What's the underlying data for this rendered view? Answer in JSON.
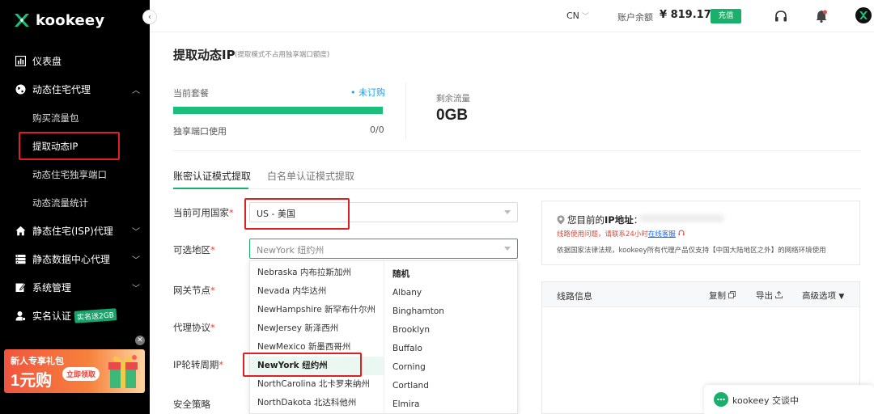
{
  "brand": {
    "name": "kookeey"
  },
  "sidebar": {
    "items": [
      {
        "label": "仪表盘",
        "icon": "dashboard-icon"
      },
      {
        "label": "动态住宅代理",
        "icon": "globe-icon",
        "expanded": true,
        "children": [
          "购买流量包",
          "提取动态IP",
          "动态住宅独享端口",
          "动态流量统计"
        ]
      },
      {
        "label": "静态住宅(ISP)代理",
        "icon": "home-icon"
      },
      {
        "label": "静态数据中心代理",
        "icon": "server-icon"
      },
      {
        "label": "系统管理",
        "icon": "edit-icon"
      },
      {
        "label": "实名认证",
        "icon": "user-icon",
        "badge": "实名送2GB"
      }
    ],
    "promo": {
      "line1": "新人专享礼包",
      "line2": "1元购",
      "cta": "立即领取"
    }
  },
  "topbar": {
    "lang": "CN",
    "balance_label": "账户余额",
    "balance": "¥ 819.17",
    "recharge": "充值"
  },
  "page": {
    "title": "提取动态IP",
    "subtitle": "(提取模式不占用独享端口额度)"
  },
  "package": {
    "label": "当前套餐",
    "status": "• 未订购",
    "port_label": "独享端口使用",
    "port_value": "0/0",
    "remain_label": "剩余流量",
    "remain_value": "0GB"
  },
  "tabs": [
    "账密认证模式提取",
    "白名单认证模式提取"
  ],
  "form": {
    "country_label": "当前可用国家",
    "country_value": "US - 美国",
    "region_label": "可选地区",
    "region_placeholder": "NewYork 纽约州",
    "gateway_label": "网关节点",
    "protocol_label": "代理协议",
    "rotation_label": "IP轮转周期",
    "security_label": "安全策略",
    "required_mark": "*"
  },
  "dropdown": {
    "states": [
      "Nebraska 内布拉斯加州",
      "Nevada 内华达州",
      "NewHampshire 新罕布什尔州",
      "NewJersey 新泽西州",
      "NewMexico 新墨西哥州",
      "NewYork 纽约州",
      "NorthCarolina 北卡罗来纳州",
      "NorthDakota 北达科他州"
    ],
    "selected_state": "NewYork 纽约州",
    "cities": [
      "随机",
      "Albany",
      "Binghamton",
      "Brooklyn",
      "Buffalo",
      "Corning",
      "Cortland",
      "Elmira"
    ]
  },
  "ip_panel": {
    "title_prefix": "您目前的",
    "title_bold": "IP地址",
    "title_suffix": "：",
    "warn_prefix": "线路使用问题，请联系24小时",
    "warn_link": "在线客服",
    "note": "依据国家法律法规，kookeey所有代理产品仅支持【中国大陆地区之外】的网络环境使用"
  },
  "line_panel": {
    "title": "线路信息",
    "copy": "复制",
    "export": "导出",
    "advanced": "高级选项"
  },
  "chat": {
    "label": "kookeey  交谈中"
  },
  "colors": {
    "accent": "#1aaf6a",
    "sidebar_bg": "#000000",
    "highlight_red": "#e02020",
    "link_blue": "#1a9df0"
  }
}
